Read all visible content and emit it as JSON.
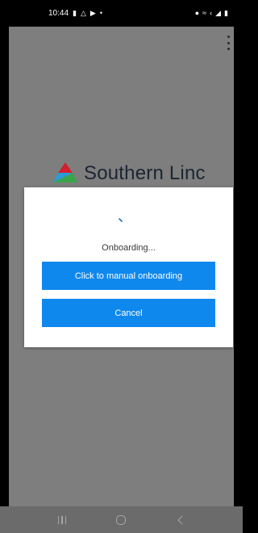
{
  "status_bar": {
    "time": "10:44",
    "left_icons": [
      "battery-saver-icon",
      "network-share-icon",
      "cast-icon",
      "dot-icon"
    ],
    "right_icons": [
      "location-icon",
      "wifi-calling-icon",
      "lte-icon",
      "signal-icon",
      "battery-icon"
    ]
  },
  "app": {
    "menu_icon": "overflow-menu-icon",
    "logo_text": "Southern Linc",
    "logo_colors": {
      "red": "#d2202f",
      "green": "#3aa44b",
      "blue": "#2a9bd6"
    }
  },
  "dialog": {
    "status_text": "Onboarding...",
    "manual_button_label": "Click to manual onboarding",
    "cancel_button_label": "Cancel",
    "button_color": "#0f88ee"
  },
  "nav_bar": {
    "buttons": [
      "recents-icon",
      "home-icon",
      "back-icon"
    ]
  }
}
